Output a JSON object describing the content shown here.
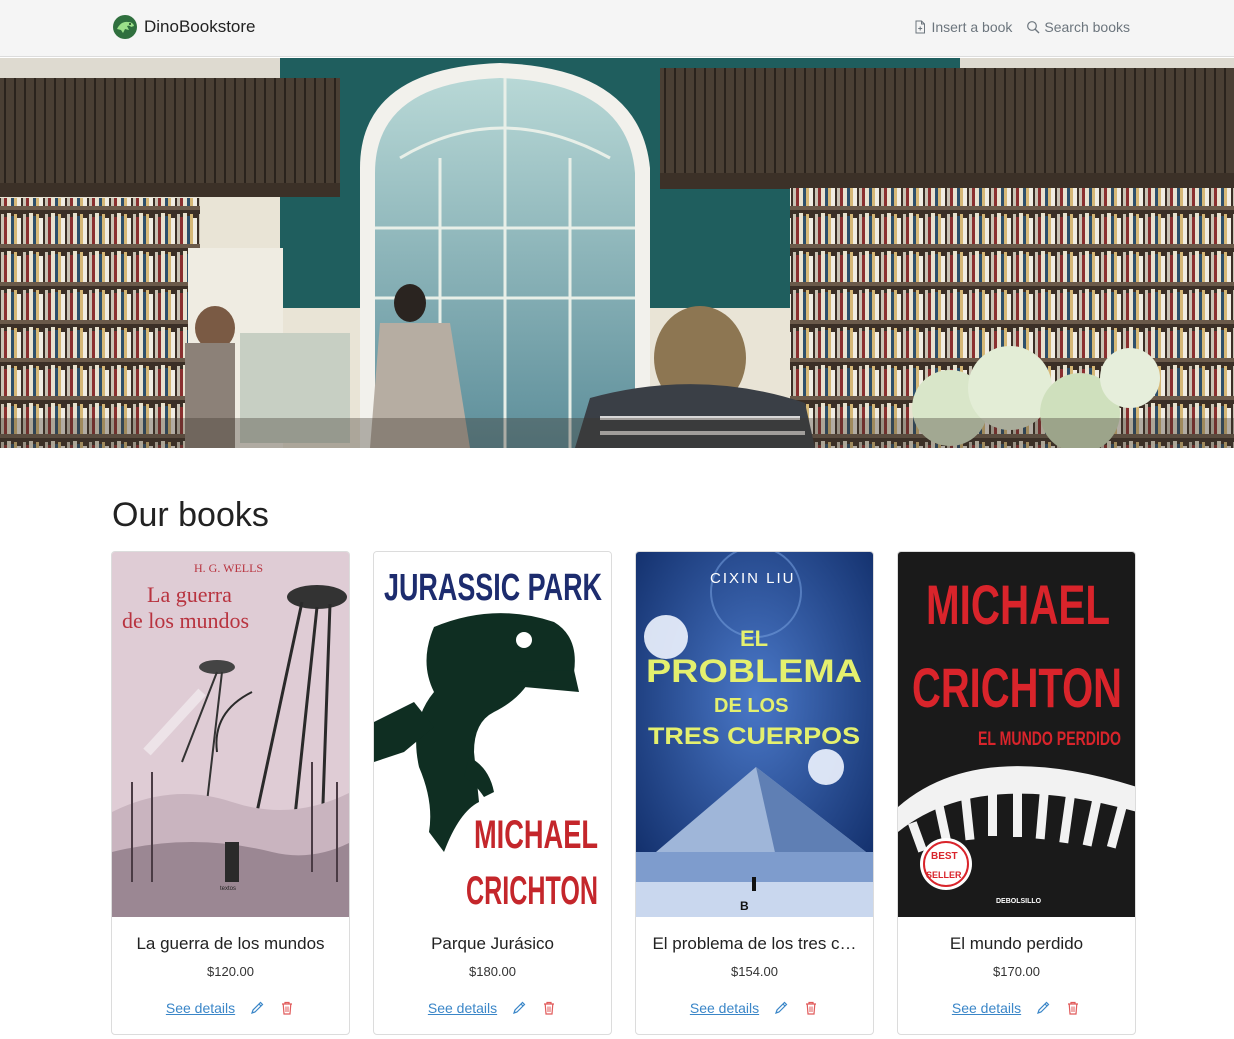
{
  "navbar": {
    "brand": "DinoBookstore",
    "links": [
      {
        "label": "Insert a book",
        "icon": "file-plus-icon"
      },
      {
        "label": "Search books",
        "icon": "search-icon"
      }
    ]
  },
  "main": {
    "title": "Our books",
    "books": [
      {
        "title": "La guerra de los mundos",
        "price": "$120.00",
        "details_label": "See details",
        "cover": {
          "author": "H. G. WELLS",
          "line1": "La guerra",
          "line2": "de los mundos",
          "publisher": "textos"
        }
      },
      {
        "title": "Parque Jurásico",
        "price": "$180.00",
        "details_label": "See details",
        "cover": {
          "line1": "JURASSIC PARK",
          "line2": "MICHAEL",
          "line3": "CRICHTON"
        }
      },
      {
        "title": "El problema de los tres c…",
        "price": "$154.00",
        "details_label": "See details",
        "cover": {
          "author": "CIXIN LIU",
          "line1": "EL",
          "line2": "PROBLEMA",
          "line3": "DE LOS",
          "line4": "TRES CUERPOS",
          "publisher": "B"
        }
      },
      {
        "title": "El mundo perdido",
        "price": "$170.00",
        "details_label": "See details",
        "cover": {
          "line1": "MICHAEL",
          "line2": "CRICHTON",
          "line3": "EL MUNDO PERDIDO",
          "badge1": "BEST",
          "badge2": "SELLER",
          "publisher": "DEBOLSILLO"
        }
      }
    ]
  },
  "colors": {
    "link": "#3a86c8",
    "delete": "#e15a5a",
    "navbar_bg": "#f5f5f5"
  }
}
